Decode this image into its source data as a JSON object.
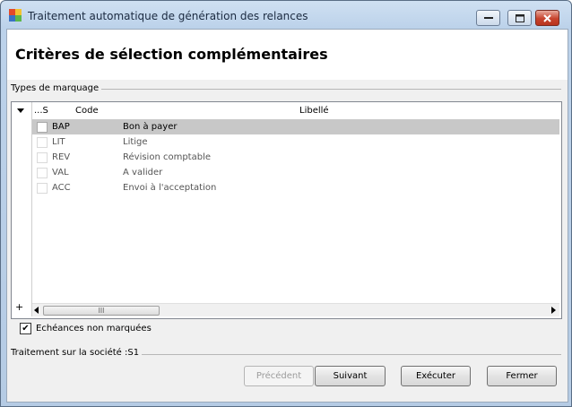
{
  "window": {
    "title": "Traitement automatique de génération des relances",
    "minimize_icon": "minimize-icon",
    "maximize_icon": "maximize-icon",
    "close_icon": "close-icon"
  },
  "page": {
    "title": "Critères de sélection complémentaires"
  },
  "marking_group": {
    "label": "Types de marquage",
    "columns": {
      "select": "...S",
      "code": "Code",
      "label": "Libellé"
    },
    "rows": [
      {
        "code": "BAP",
        "label": "Bon à payer",
        "checked": false,
        "selected": true
      },
      {
        "code": "LIT",
        "label": "Litige",
        "checked": false,
        "selected": false
      },
      {
        "code": "REV",
        "label": "Révision comptable",
        "checked": false,
        "selected": false
      },
      {
        "code": "VAL",
        "label": "A valider",
        "checked": false,
        "selected": false
      },
      {
        "code": "ACC",
        "label": "Envoi à l'acceptation",
        "checked": false,
        "selected": false
      }
    ],
    "add_symbol": "+",
    "scroll_thumb": "lll"
  },
  "unmarked_checkbox": {
    "label": "Echéances non marquées",
    "checked": true,
    "mark": "✔"
  },
  "company_group": {
    "label": "Traitement sur la société :S1"
  },
  "buttons": {
    "previous": "Précédent",
    "next": "Suivant",
    "execute": "Exécuter",
    "close": "Fermer"
  }
}
